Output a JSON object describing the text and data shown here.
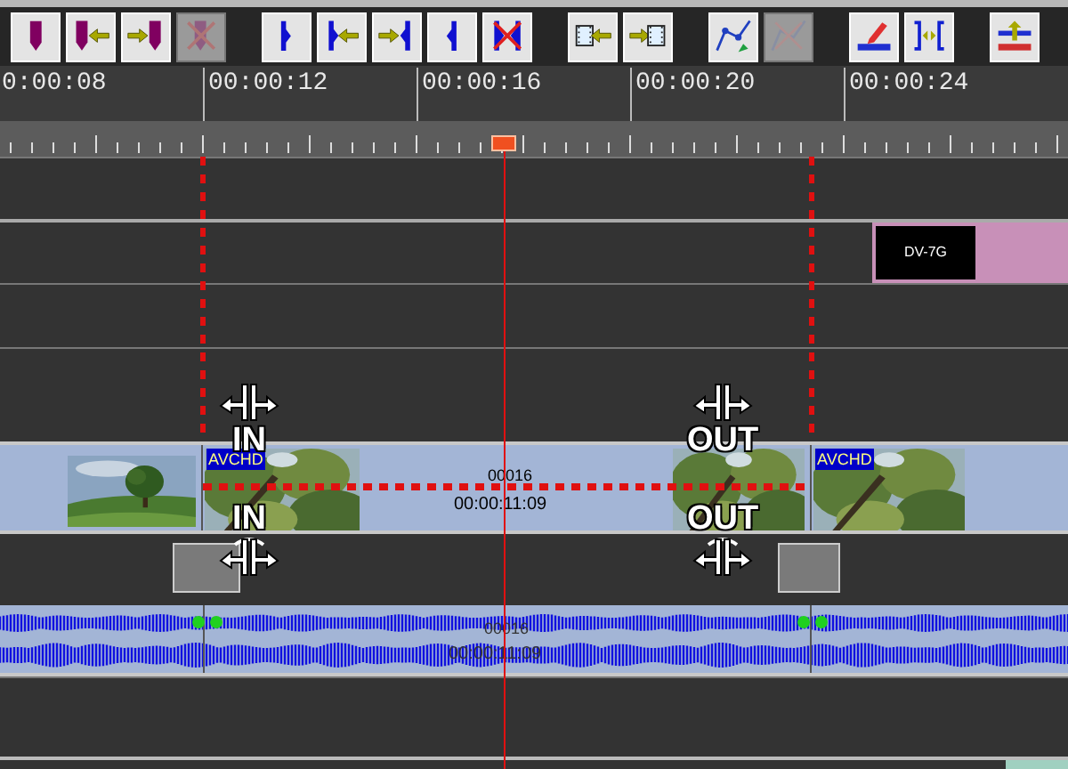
{
  "toolbar": {
    "groups": [
      {
        "buttons": [
          {
            "kind": "marker",
            "disabled": false
          },
          {
            "kind": "marker-in",
            "disabled": false
          },
          {
            "kind": "marker-out",
            "disabled": false
          },
          {
            "kind": "marker-delete",
            "disabled": true
          }
        ]
      },
      {
        "buttons": [
          {
            "kind": "split-right",
            "disabled": false
          },
          {
            "kind": "split-in",
            "disabled": false
          },
          {
            "kind": "split-out",
            "disabled": false
          },
          {
            "kind": "split-left",
            "disabled": false
          },
          {
            "kind": "split-delete",
            "disabled": false
          }
        ]
      },
      {
        "buttons": [
          {
            "kind": "film-in",
            "disabled": false
          },
          {
            "kind": "film-out",
            "disabled": false
          }
        ]
      },
      {
        "buttons": [
          {
            "kind": "curve",
            "disabled": false
          },
          {
            "kind": "curve-delete",
            "disabled": true
          }
        ]
      },
      {
        "buttons": [
          {
            "kind": "pen",
            "disabled": false
          },
          {
            "kind": "gap",
            "disabled": false
          }
        ]
      },
      {
        "buttons": [
          {
            "kind": "lift",
            "disabled": false
          }
        ]
      }
    ]
  },
  "timecodes": [
    "0:00:08",
    "00:00:12",
    "00:00:16",
    "00:00:20",
    "00:00:24"
  ],
  "tracks": [
    {
      "kind": "empty"
    },
    {
      "kind": "title",
      "clip": {
        "label": "DV-7G"
      }
    },
    {
      "kind": "empty"
    },
    {
      "kind": "empty"
    },
    {
      "kind": "video",
      "badges": [
        "AVCHD",
        "AVCHD"
      ],
      "counter": "00016",
      "timecode": "00:00:11:09"
    },
    {
      "kind": "handles"
    },
    {
      "kind": "audio",
      "counter": "00016",
      "timecode": "00:00:11:09"
    },
    {
      "kind": "empty"
    }
  ],
  "cursors_above": [
    {
      "label": "IN"
    },
    {
      "label": "OUT"
    }
  ],
  "cursors_below": [
    {
      "label": "IN"
    },
    {
      "label": "OUT"
    }
  ]
}
